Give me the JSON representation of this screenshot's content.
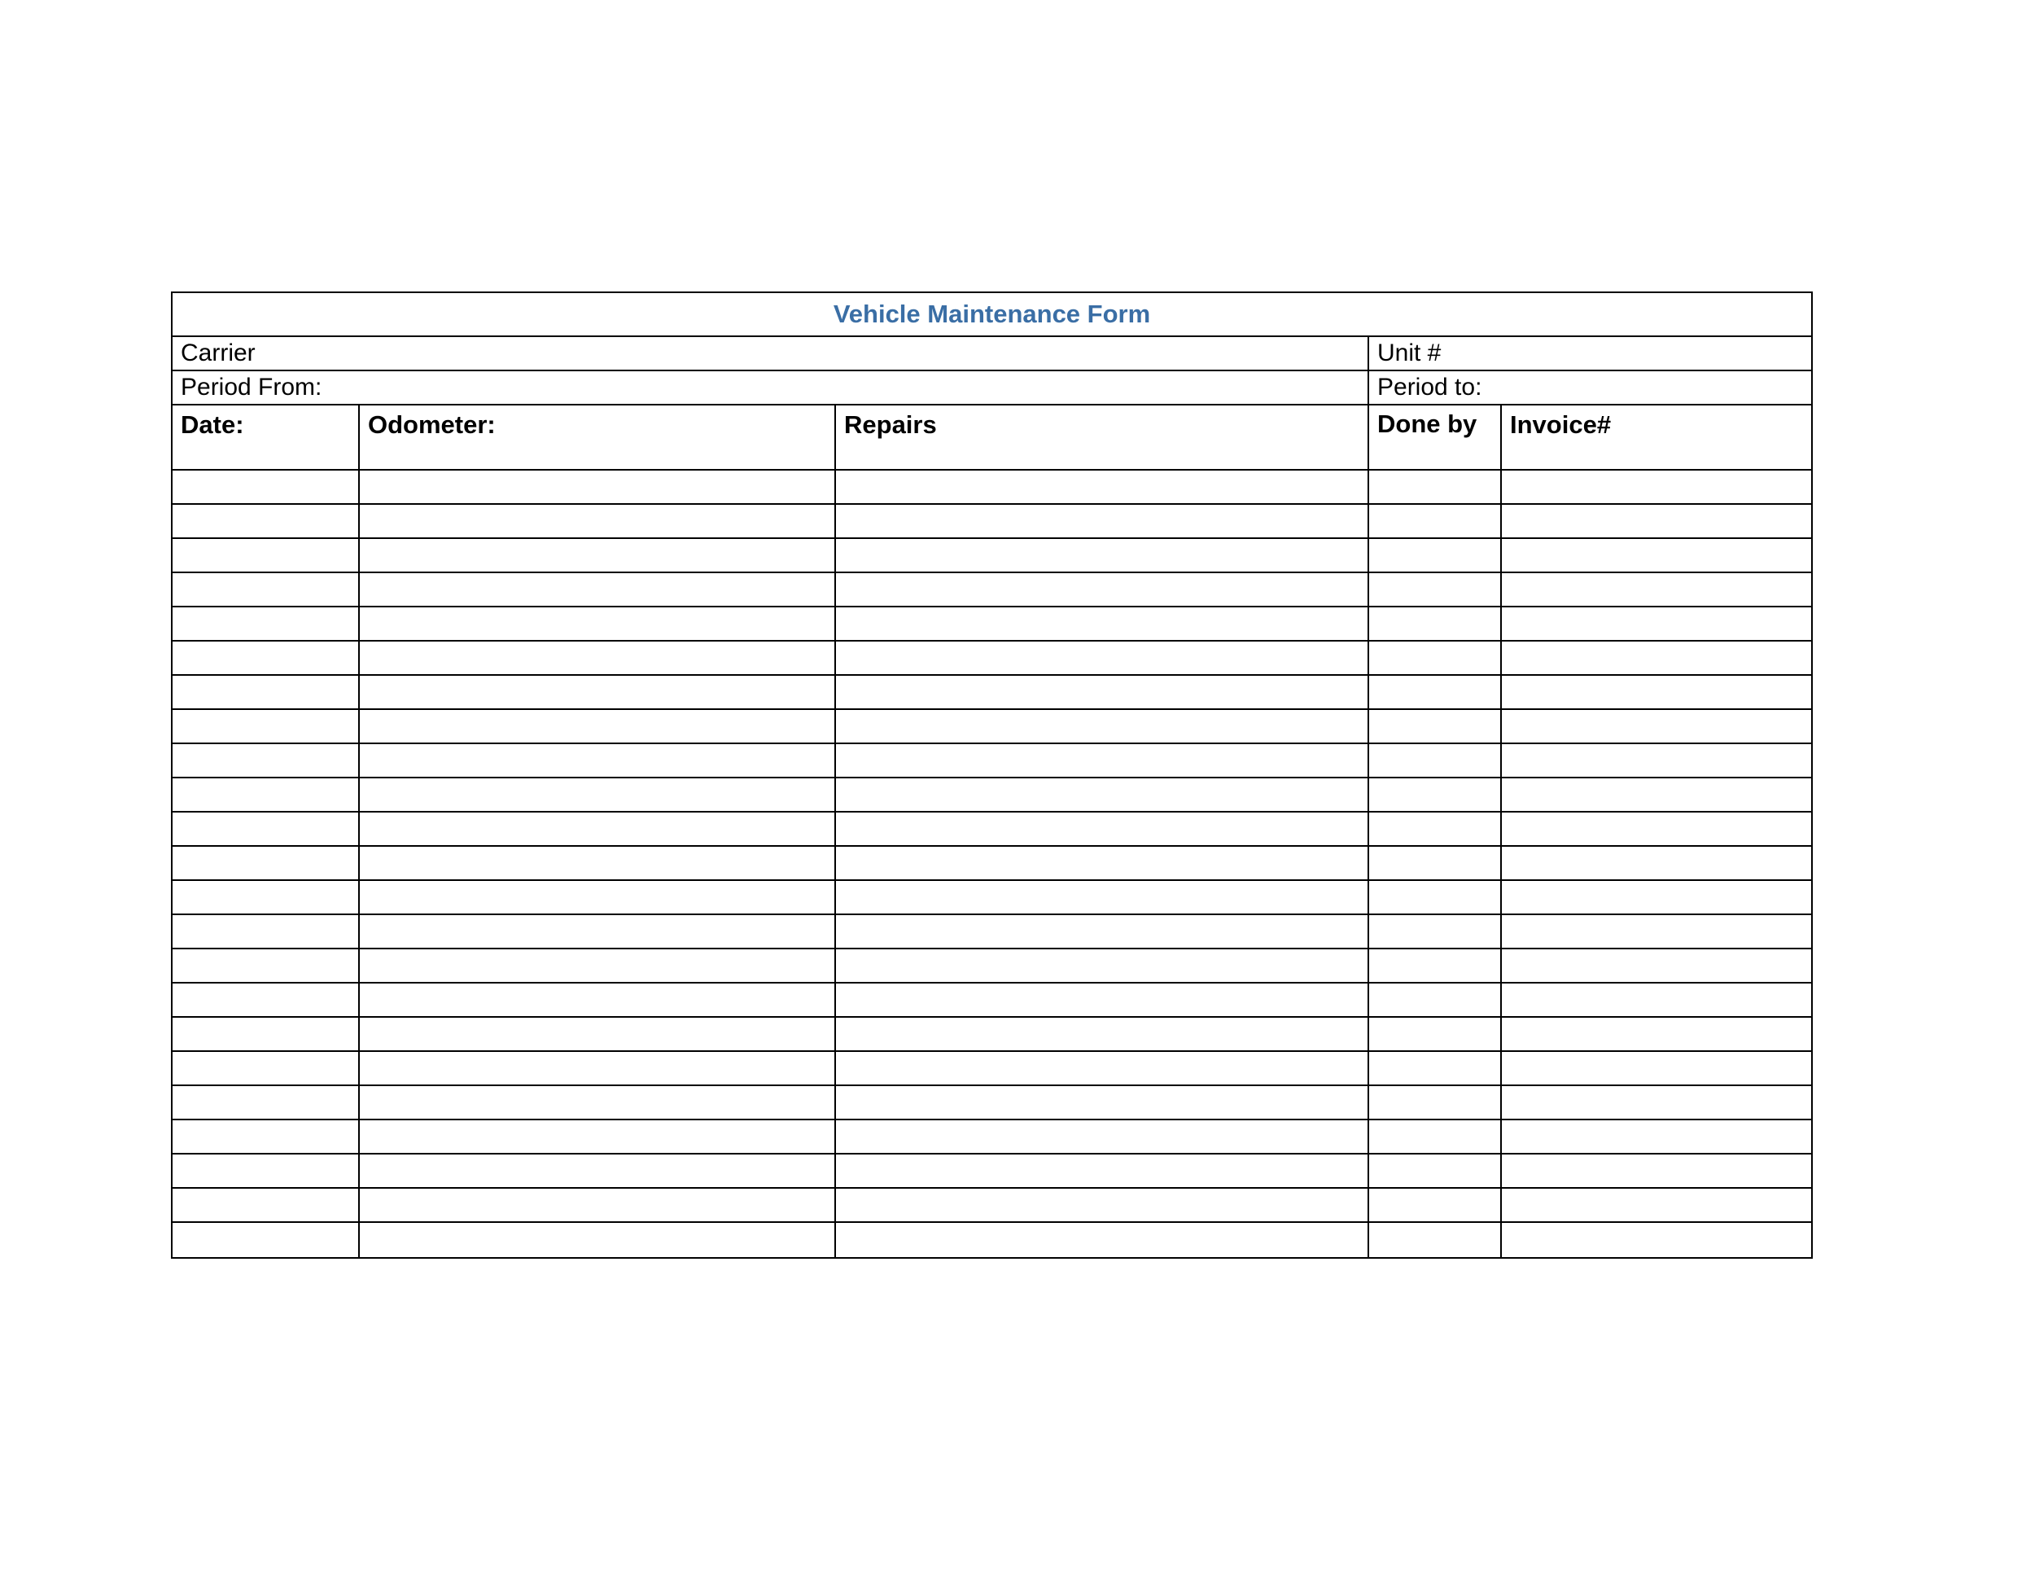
{
  "title": "Vehicle Maintenance Form",
  "info": {
    "carrier_label": "Carrier",
    "unit_label": "Unit #",
    "period_from_label": "Period From:",
    "period_to_label": "Period to:"
  },
  "headers": {
    "date": "Date:",
    "odometer": "Odometer:",
    "repairs": "Repairs",
    "done_by": "Done by",
    "invoice": "Invoice#"
  },
  "rows": [
    {
      "date": "",
      "odometer": "",
      "repairs": "",
      "done_by": "",
      "invoice": ""
    },
    {
      "date": "",
      "odometer": "",
      "repairs": "",
      "done_by": "",
      "invoice": ""
    },
    {
      "date": "",
      "odometer": "",
      "repairs": "",
      "done_by": "",
      "invoice": ""
    },
    {
      "date": "",
      "odometer": "",
      "repairs": "",
      "done_by": "",
      "invoice": ""
    },
    {
      "date": "",
      "odometer": "",
      "repairs": "",
      "done_by": "",
      "invoice": ""
    },
    {
      "date": "",
      "odometer": "",
      "repairs": "",
      "done_by": "",
      "invoice": ""
    },
    {
      "date": "",
      "odometer": "",
      "repairs": "",
      "done_by": "",
      "invoice": ""
    },
    {
      "date": "",
      "odometer": "",
      "repairs": "",
      "done_by": "",
      "invoice": ""
    },
    {
      "date": "",
      "odometer": "",
      "repairs": "",
      "done_by": "",
      "invoice": ""
    },
    {
      "date": "",
      "odometer": "",
      "repairs": "",
      "done_by": "",
      "invoice": ""
    },
    {
      "date": "",
      "odometer": "",
      "repairs": "",
      "done_by": "",
      "invoice": ""
    },
    {
      "date": "",
      "odometer": "",
      "repairs": "",
      "done_by": "",
      "invoice": ""
    },
    {
      "date": "",
      "odometer": "",
      "repairs": "",
      "done_by": "",
      "invoice": ""
    },
    {
      "date": "",
      "odometer": "",
      "repairs": "",
      "done_by": "",
      "invoice": ""
    },
    {
      "date": "",
      "odometer": "",
      "repairs": "",
      "done_by": "",
      "invoice": ""
    },
    {
      "date": "",
      "odometer": "",
      "repairs": "",
      "done_by": "",
      "invoice": ""
    },
    {
      "date": "",
      "odometer": "",
      "repairs": "",
      "done_by": "",
      "invoice": ""
    },
    {
      "date": "",
      "odometer": "",
      "repairs": "",
      "done_by": "",
      "invoice": ""
    },
    {
      "date": "",
      "odometer": "",
      "repairs": "",
      "done_by": "",
      "invoice": ""
    },
    {
      "date": "",
      "odometer": "",
      "repairs": "",
      "done_by": "",
      "invoice": ""
    },
    {
      "date": "",
      "odometer": "",
      "repairs": "",
      "done_by": "",
      "invoice": ""
    },
    {
      "date": "",
      "odometer": "",
      "repairs": "",
      "done_by": "",
      "invoice": ""
    },
    {
      "date": "",
      "odometer": "",
      "repairs": "",
      "done_by": "",
      "invoice": ""
    }
  ]
}
